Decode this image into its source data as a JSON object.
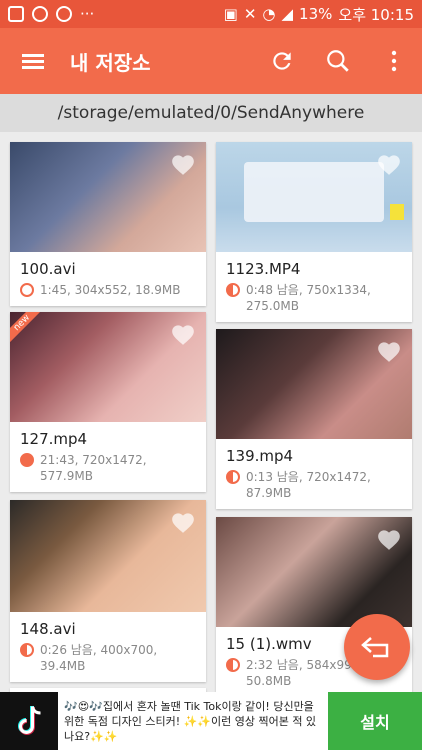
{
  "status_bar": {
    "battery": "13%",
    "time": "오후 10:15",
    "more": "···"
  },
  "app_bar": {
    "title": "내 저장소"
  },
  "path": "/storage/emulated/0/SendAnywhere",
  "files": [
    {
      "name": "100.avi",
      "meta_line1": "1:45, 304x552, 18.9MB",
      "meta_line2": "",
      "progress": "empty",
      "is_new": false
    },
    {
      "name": "1123.MP4",
      "meta_line1": "0:48 남음, 750x1334,",
      "meta_line2": "275.0MB",
      "progress": "half",
      "is_new": false
    },
    {
      "name": "127.mp4",
      "meta_line1": "21:43, 720x1472,",
      "meta_line2": "577.9MB",
      "progress": "full",
      "is_new": true,
      "new_label": "new"
    },
    {
      "name": "139.mp4",
      "meta_line1": "0:13 남음, 720x1472,",
      "meta_line2": "87.9MB",
      "progress": "half",
      "is_new": false
    },
    {
      "name": "148.avi",
      "meta_line1": "0:26 남음, 400x700,",
      "meta_line2": "39.4MB",
      "progress": "half",
      "is_new": false
    },
    {
      "name": "15 (1).wmv",
      "meta_line1": "2:32 남음, 584x99",
      "meta_line2": "50.8MB",
      "progress": "half",
      "is_new": false
    }
  ],
  "ad": {
    "text": "🎶😍🎶집에서 혼자 놀땐 Tik Tok이랑 같이! 당신만을 위한 독점 디자인 스티커! ✨✨이런 영상 찍어본 적 있나요?✨✨",
    "button": "설치"
  },
  "colors": {
    "accent": "#f26b4b",
    "status_bar": "#e8563a",
    "install_green": "#3cb043"
  }
}
